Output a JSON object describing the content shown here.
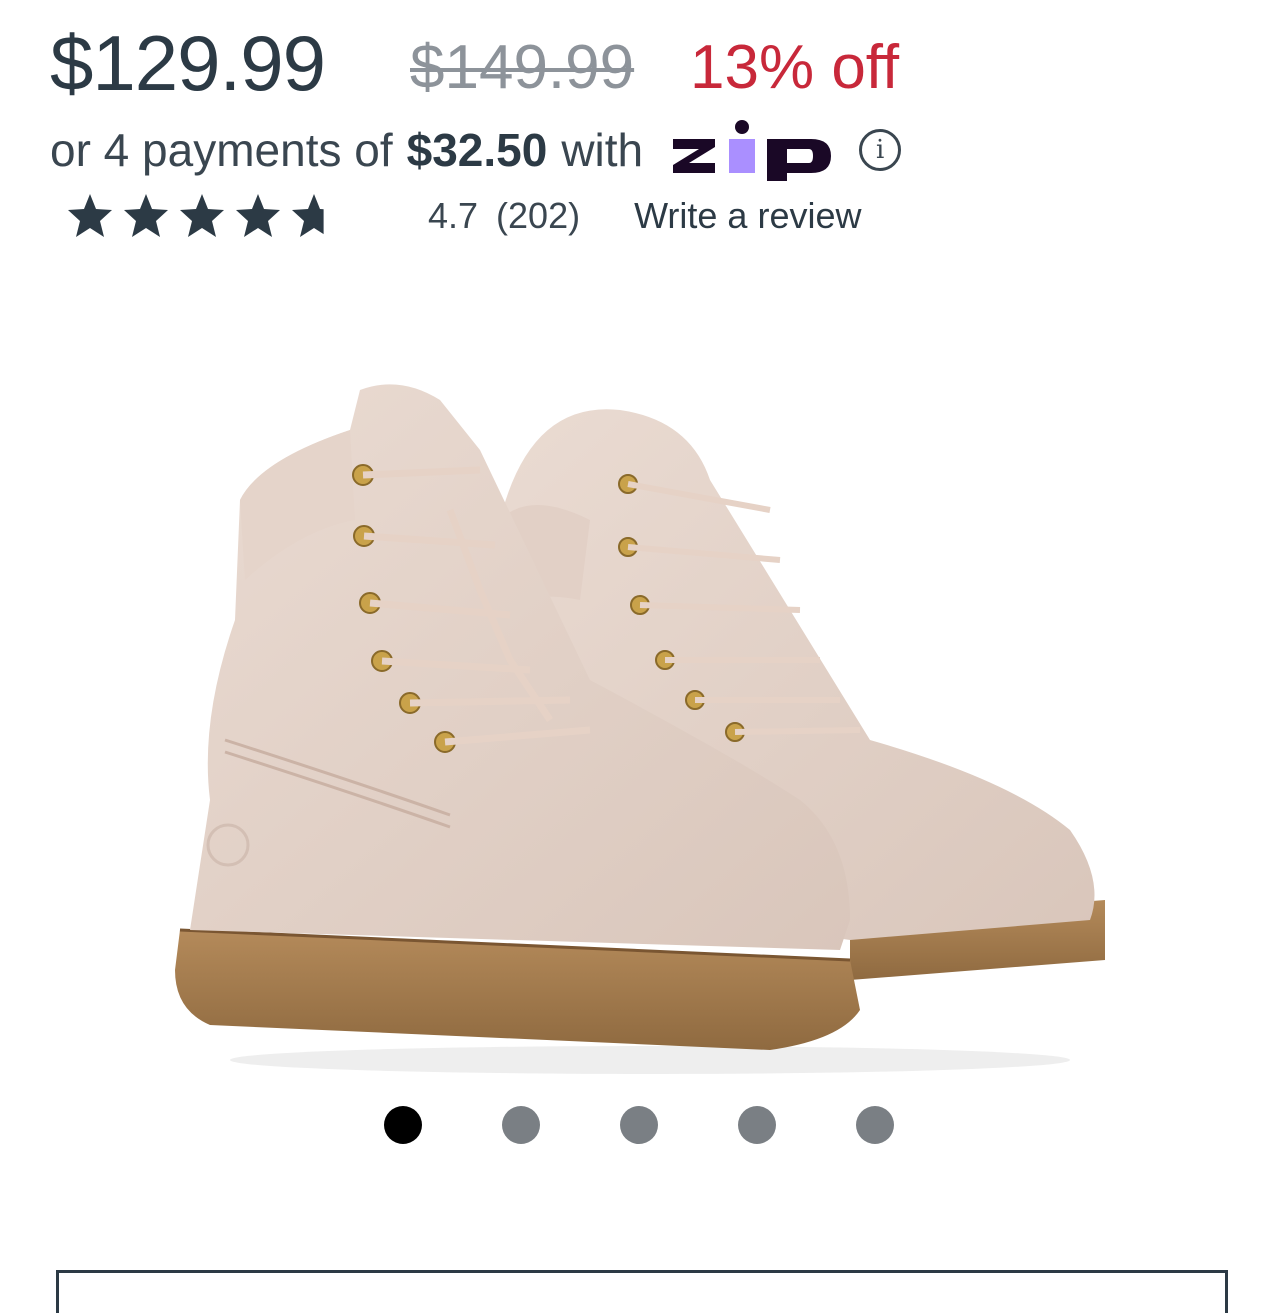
{
  "pricing": {
    "current": "$129.99",
    "original": "$149.99",
    "discount": "13% off"
  },
  "payment": {
    "prefix": "or 4 payments of",
    "amount": "$32.50",
    "suffix": "with",
    "provider_logo_text": "zip"
  },
  "rating": {
    "value": "4.7",
    "count": "(202)",
    "stars_value": 4.7,
    "stars_max": 5,
    "write_review_label": "Write a review"
  },
  "carousel": {
    "total": 5,
    "active_index": 0
  },
  "colors": {
    "discount": "#c8283a",
    "star": "#2c3a45",
    "dot_active": "#000000",
    "dot_inactive": "#7a7f84",
    "zip_purple": "#aa8fff",
    "zip_dark": "#1a0826"
  },
  "icons": {
    "info": "info-icon",
    "star": "star-icon"
  }
}
